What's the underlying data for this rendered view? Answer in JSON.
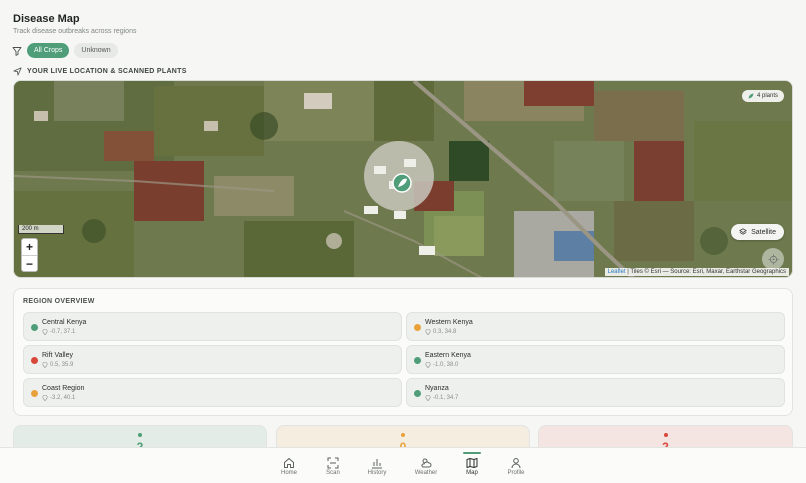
{
  "header": {
    "title": "Disease Map",
    "subtitle": "Track disease outbreaks across regions"
  },
  "filters": {
    "icon": "filter-icon",
    "chips": [
      {
        "label": "All Crops",
        "active": true
      },
      {
        "label": "Unknown",
        "active": false
      }
    ]
  },
  "map_section": {
    "heading": "YOUR LIVE LOCATION & SCANNED PLANTS",
    "icon": "navigation-icon"
  },
  "map": {
    "plants_badge": "4 plants",
    "scale_label": "200 m",
    "zoom_in": "+",
    "zoom_out": "−",
    "layer_button": "Satellite",
    "attribution_link": "Leaflet",
    "attribution_text": " | Tiles © Esri — Source: Esri, Maxar, Earthstar Geographics"
  },
  "region_overview": {
    "title": "REGION OVERVIEW",
    "regions": [
      {
        "name": "Central Kenya",
        "coords": "-0.7, 37.1",
        "color": "#4f9e79"
      },
      {
        "name": "Western Kenya",
        "coords": "0.3, 34.8",
        "color": "#e9a23b"
      },
      {
        "name": "Rift Valley",
        "coords": "0.5, 35.9",
        "color": "#d9473a"
      },
      {
        "name": "Eastern Kenya",
        "coords": "-1.0, 38.0",
        "color": "#4f9e79"
      },
      {
        "name": "Coast Region",
        "coords": "-3.2, 40.1",
        "color": "#e9a23b"
      },
      {
        "name": "Nyanza",
        "coords": "-0.1, 34.7",
        "color": "#4f9e79"
      }
    ]
  },
  "stats": [
    {
      "value": "2",
      "color": "#4f9e79",
      "bg": "#e3ece6"
    },
    {
      "value": "0",
      "color": "#e9a23b",
      "bg": "#f5ede0"
    },
    {
      "value": "2",
      "color": "#d9473a",
      "bg": "#f4e4e2"
    }
  ],
  "bottom_nav": [
    {
      "label": "Home",
      "icon": "home-icon",
      "active": false
    },
    {
      "label": "Scan",
      "icon": "scan-icon",
      "active": false
    },
    {
      "label": "History",
      "icon": "history-chart-icon",
      "active": false
    },
    {
      "label": "Weather",
      "icon": "weather-icon",
      "active": false
    },
    {
      "label": "Map",
      "icon": "map-icon",
      "active": true
    },
    {
      "label": "Profile",
      "icon": "profile-icon",
      "active": false
    }
  ]
}
